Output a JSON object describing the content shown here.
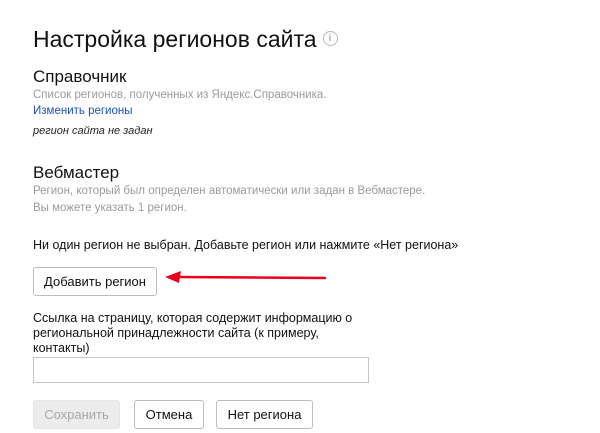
{
  "page": {
    "title": "Настройка регионов сайта",
    "info_icon": "info-icon"
  },
  "directory_section": {
    "heading": "Справочник",
    "description": "Список регионов, полученных из Яндекс.Справочника.",
    "edit_link": "Изменить регионы",
    "status": "регион сайта не задан"
  },
  "webmaster_section": {
    "heading": "Вебмастер",
    "description_line1": "Регион, который был определен автоматически или задан в Вебмастере.",
    "description_line2": "Вы можете указать 1 регион."
  },
  "notice": "Ни один регион не выбран. Добавьте регион или нажмите «Нет региона»",
  "add_region_button": "Добавить регион",
  "annotation": {
    "arrow_color": "#e8001c"
  },
  "url_field": {
    "label_line1": "Ссылка на страницу, которая содержит информацию о",
    "label_line2": "региональной принадлежности сайта (к примеру,",
    "label_line3": "контакты)",
    "value": "",
    "placeholder": ""
  },
  "actions": {
    "save": "Сохранить",
    "cancel": "Отмена",
    "no_region": "Нет региона"
  }
}
